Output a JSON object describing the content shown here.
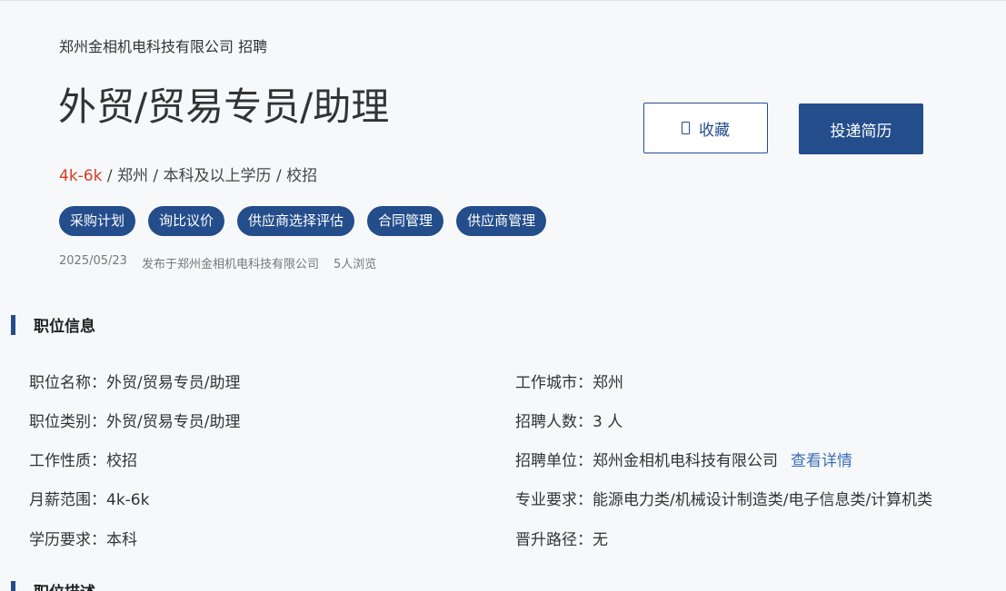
{
  "header": {
    "company_line": "郑州金相机电科技有限公司 招聘",
    "title": "外贸/贸易专员/助理",
    "salary": "4k-6k",
    "meta_rest": " / 郑州 / 本科及以上学历 / 校招",
    "tags": [
      "采购计划",
      "询比议价",
      "供应商选择评估",
      "合同管理",
      "供应商管理"
    ],
    "date": "2025/05/23",
    "publisher": "发布于郑州金相机电科技有限公司",
    "views": "5人浏览"
  },
  "actions": {
    "favorite_label": "收藏",
    "apply_label": "投递简历"
  },
  "sections": {
    "info_title": "职位信息",
    "desc_title": "职位描述"
  },
  "info": {
    "left": [
      {
        "label": "职位名称：",
        "value": "外贸/贸易专员/助理"
      },
      {
        "label": "职位类别：",
        "value": "外贸/贸易专员/助理"
      },
      {
        "label": "工作性质：",
        "value": "校招"
      },
      {
        "label": "月薪范围：",
        "value": "4k-6k"
      },
      {
        "label": "学历要求：",
        "value": "本科"
      }
    ],
    "right": [
      {
        "label": "工作城市：",
        "value": "郑州"
      },
      {
        "label": "招聘人数：",
        "value": "3 人"
      },
      {
        "label": "招聘单位：",
        "value": "郑州金相机电科技有限公司"
      },
      {
        "label": "专业要求：",
        "value": "能源电力类/机械设计制造类/电子信息类/计算机类"
      },
      {
        "label": "晋升路径：",
        "value": "无"
      }
    ],
    "detail_link": "查看详情"
  },
  "colors": {
    "accent": "#234d8b",
    "salary": "#d93a26",
    "link": "#3c6db3"
  }
}
